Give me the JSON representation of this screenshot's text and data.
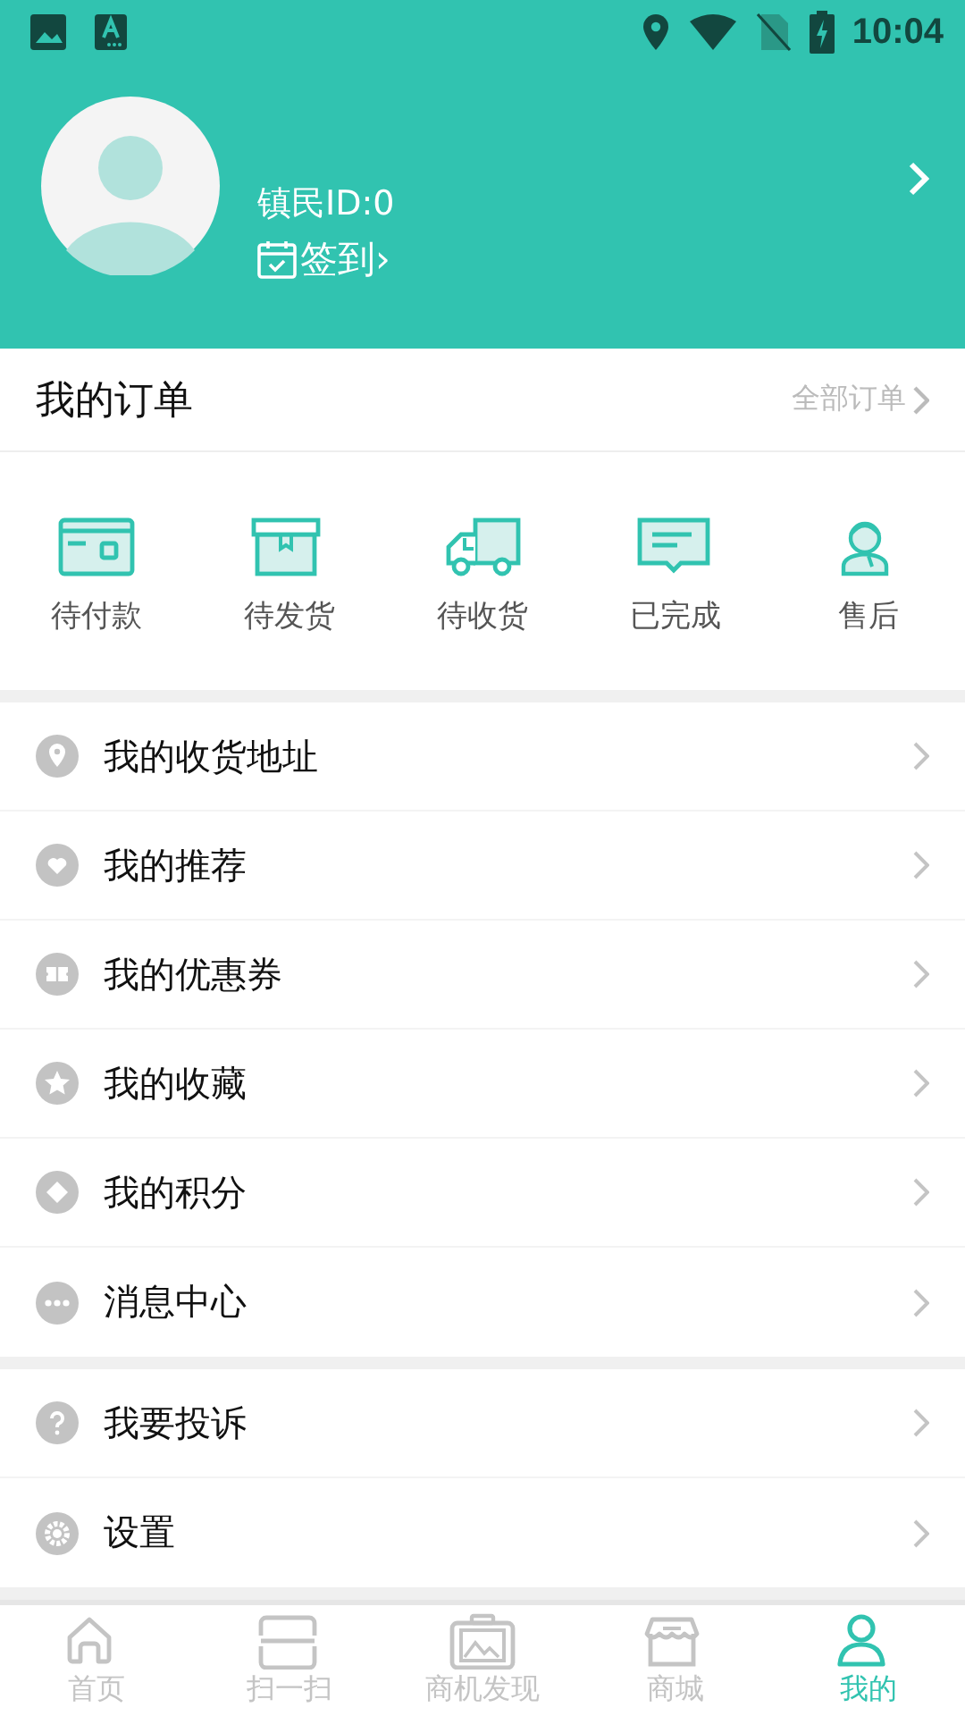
{
  "status_bar": {
    "time": "10:04"
  },
  "profile": {
    "user_id": "镇民ID:0",
    "sign_in": "签到›"
  },
  "orders": {
    "title": "我的订单",
    "all_link": "全部订单",
    "items": [
      {
        "label": "待付款"
      },
      {
        "label": "待发货"
      },
      {
        "label": "待收货"
      },
      {
        "label": "已完成"
      },
      {
        "label": "售后"
      }
    ]
  },
  "menu_groups": [
    {
      "items": [
        {
          "label": "我的收货地址"
        },
        {
          "label": "我的推荐"
        },
        {
          "label": "我的优惠券"
        },
        {
          "label": "我的收藏"
        },
        {
          "label": "我的积分"
        },
        {
          "label": "消息中心"
        }
      ]
    },
    {
      "items": [
        {
          "label": "我要投诉"
        },
        {
          "label": "设置"
        }
      ]
    }
  ],
  "tab_bar": [
    {
      "label": "首页",
      "selected": false
    },
    {
      "label": "扫一扫",
      "selected": false
    },
    {
      "label": "商机发现",
      "selected": false
    },
    {
      "label": "商城",
      "selected": false
    },
    {
      "label": "我的",
      "selected": true
    }
  ]
}
